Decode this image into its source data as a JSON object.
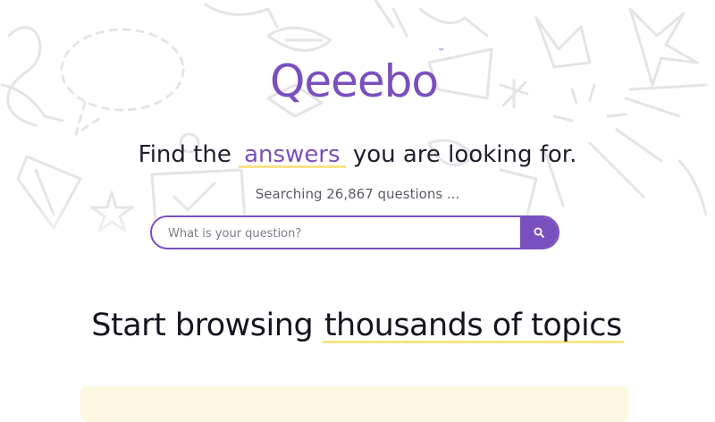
{
  "brand": {
    "name": "Qeeebo",
    "trademark": "™",
    "accent": "#7a4fbe",
    "highlight": "#f6e489"
  },
  "hero": {
    "headline_before": "Find the",
    "headline_highlight": "answers",
    "headline_after": "you are looking for.",
    "subtext": "Searching 26,867 questions ...",
    "search": {
      "placeholder": "What is your question?",
      "button_icon": "search-icon"
    }
  },
  "browse": {
    "title_before": "Start browsing",
    "title_highlight": "thousands of topics"
  },
  "icons": [
    "search-icon"
  ]
}
